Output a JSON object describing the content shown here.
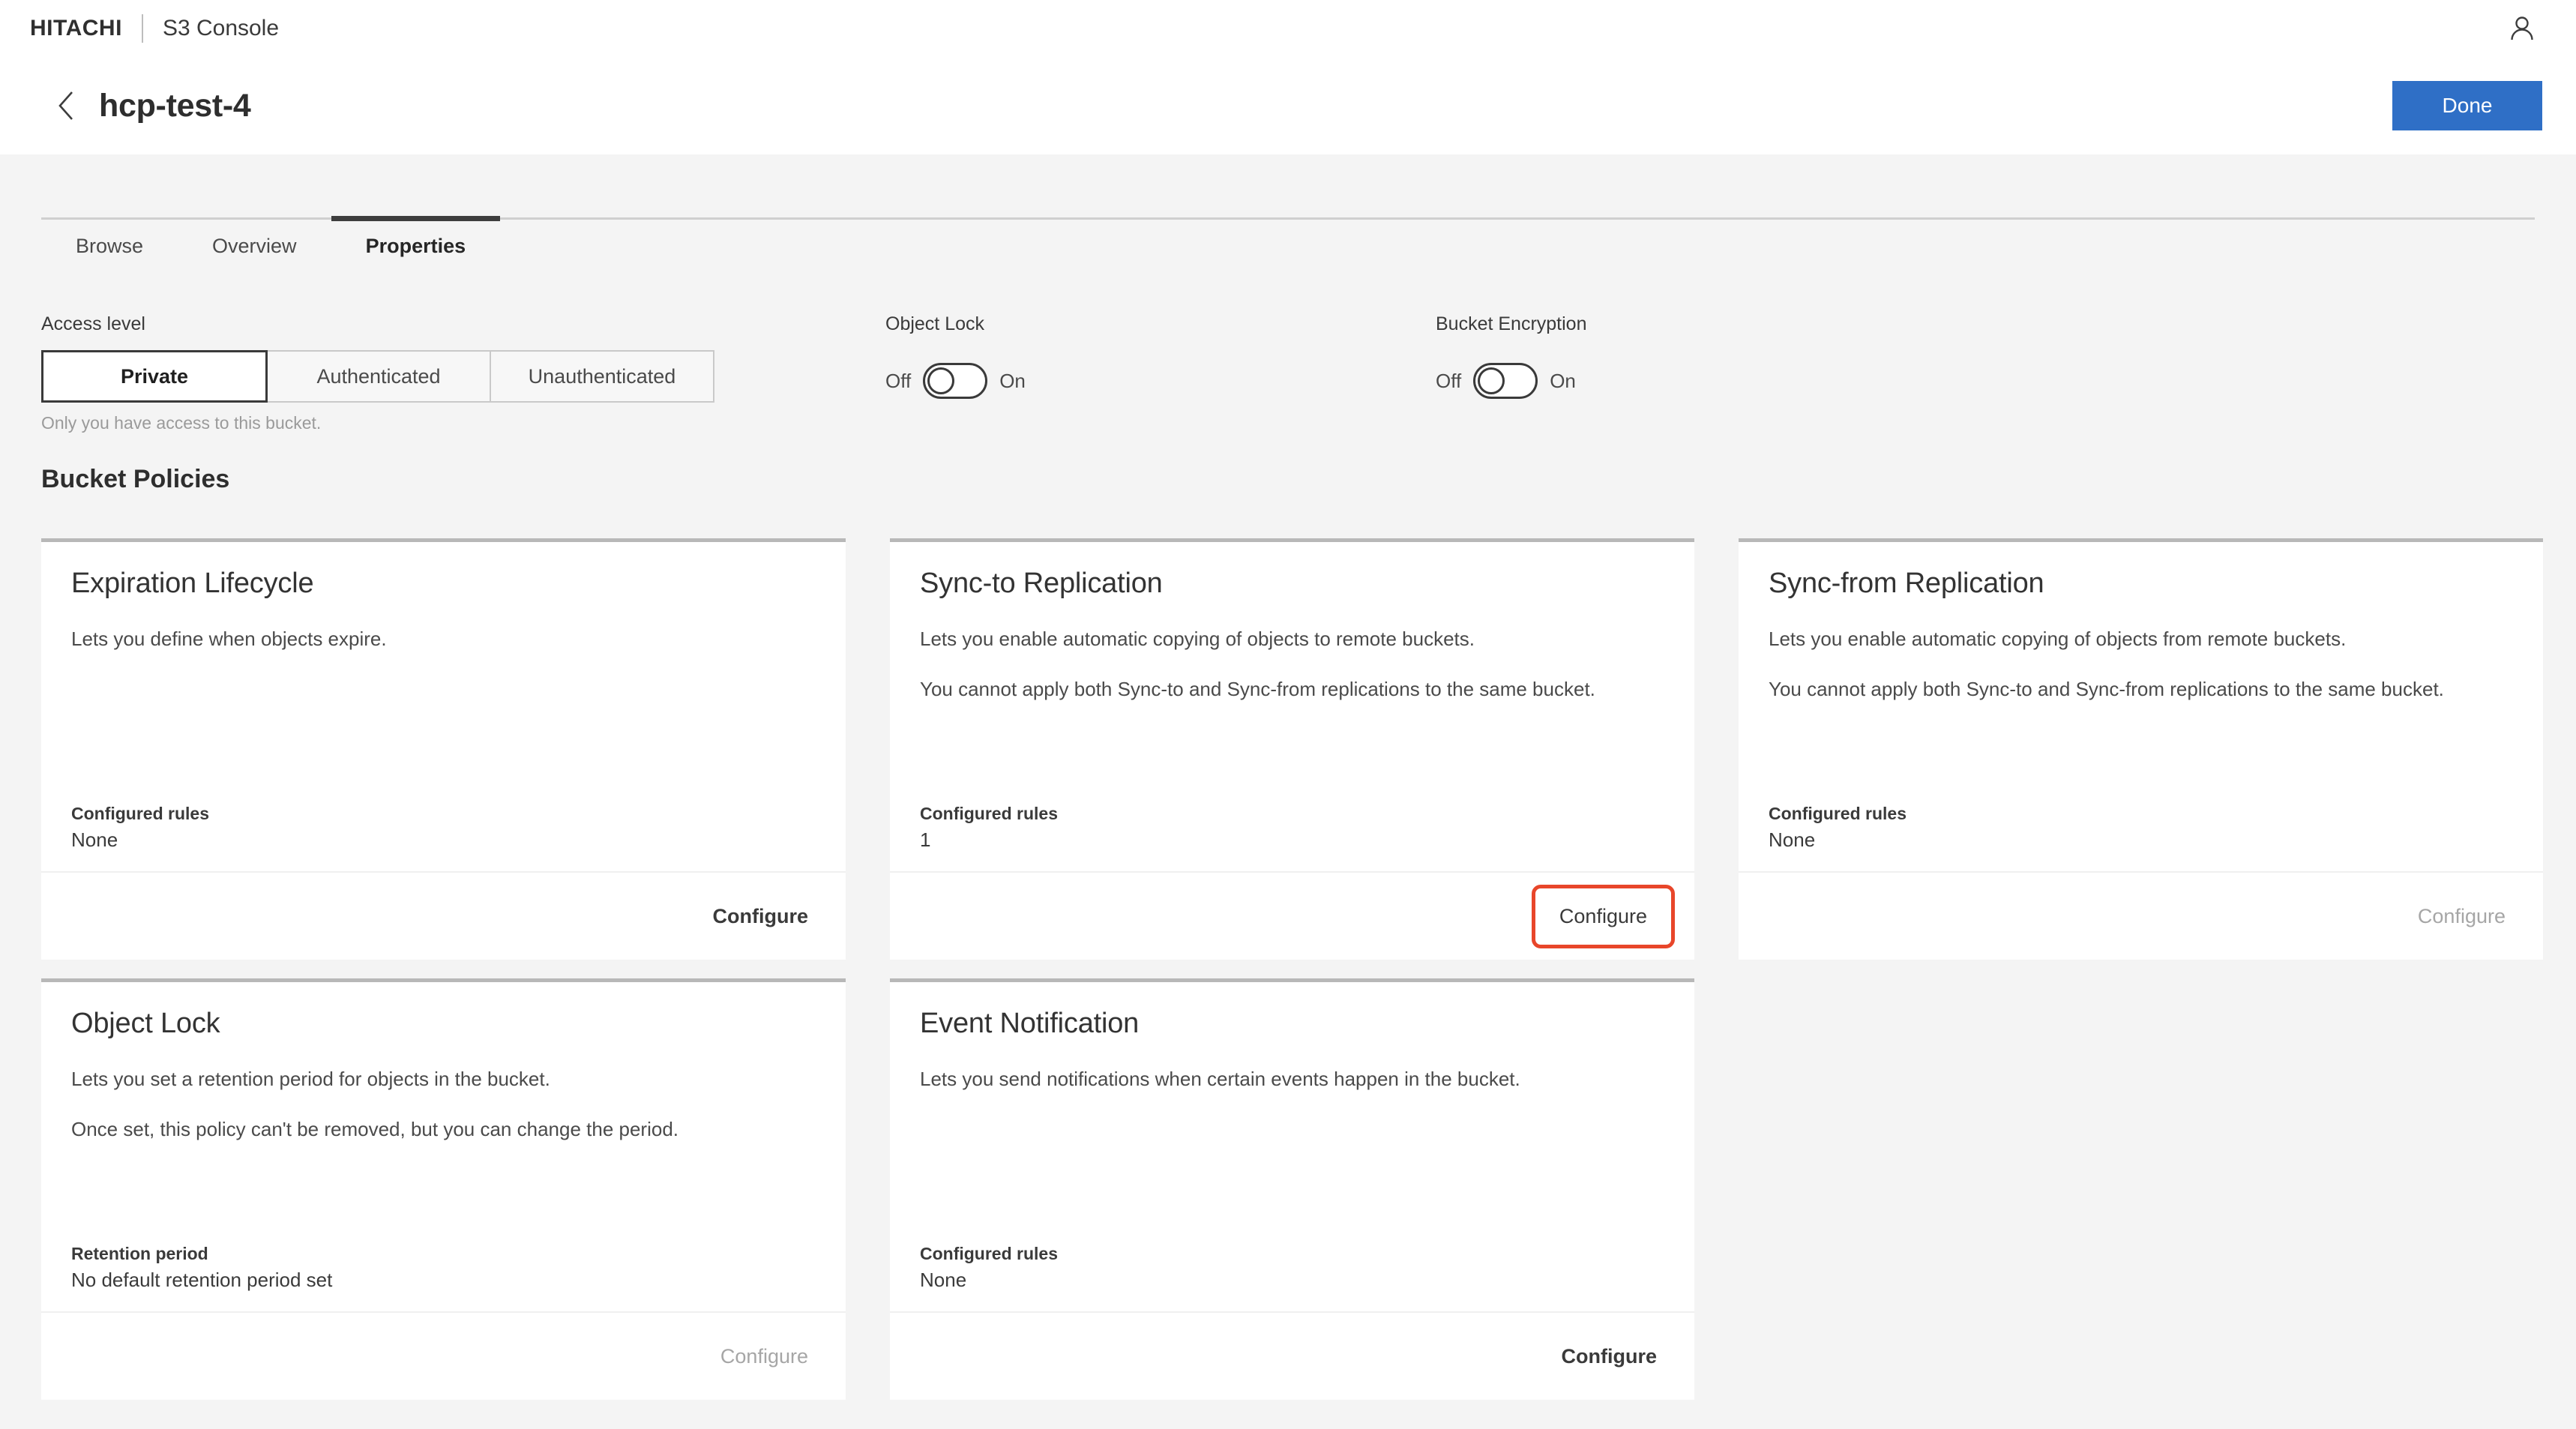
{
  "appbar": {
    "brand": "HITACHI",
    "app_title": "S3 Console",
    "user_icon": "user-avatar-icon"
  },
  "pagehead": {
    "back_icon": "chevron-left-icon",
    "title": "hcp-test-4",
    "done_label": "Done"
  },
  "tabs": [
    {
      "label": "Browse",
      "active": false
    },
    {
      "label": "Overview",
      "active": false
    },
    {
      "label": "Properties",
      "active": true
    }
  ],
  "controls": {
    "access": {
      "label": "Access level",
      "options": [
        "Private",
        "Authenticated",
        "Unauthenticated"
      ],
      "selected": "Private",
      "helper": "Only you have access to this bucket."
    },
    "object_lock": {
      "label": "Object Lock",
      "off_label": "Off",
      "on_label": "On",
      "state": "Off"
    },
    "bucket_encryption": {
      "label": "Bucket Encryption",
      "off_label": "Off",
      "on_label": "On",
      "state": "Off"
    }
  },
  "section": {
    "title": "Bucket Policies"
  },
  "cards": [
    {
      "title": "Expiration Lifecycle",
      "desc1": "Lets you define when objects expire.",
      "desc2": "",
      "meta_label": "Configured rules",
      "meta_value": "None",
      "action_label": "Configure",
      "action_state": "enabled"
    },
    {
      "title": "Sync-to Replication",
      "desc1": "Lets you enable automatic copying of objects to remote buckets.",
      "desc2": "You cannot apply both Sync-to and Sync-from replications to the same bucket.",
      "meta_label": "Configured rules",
      "meta_value": "1",
      "action_label": "Configure",
      "action_state": "focused"
    },
    {
      "title": "Sync-from Replication",
      "desc1": "Lets you enable automatic copying of objects from remote buckets.",
      "desc2": "You cannot apply both Sync-to and Sync-from replications to the same bucket.",
      "meta_label": "Configured rules",
      "meta_value": "None",
      "action_label": "Configure",
      "action_state": "disabled"
    },
    {
      "title": "Object Lock",
      "desc1": "Lets you set a retention period for objects in the bucket.",
      "desc2": "Once set, this policy can't be removed, but you can change the period.",
      "meta_label": "Retention period",
      "meta_value": "No default retention period set",
      "action_label": "Configure",
      "action_state": "disabled"
    },
    {
      "title": "Event Notification",
      "desc1": "Lets you send notifications when certain events happen in the bucket.",
      "desc2": "",
      "meta_label": "Configured rules",
      "meta_value": "None",
      "action_label": "Configure",
      "action_state": "enabled"
    }
  ],
  "colors": {
    "primary_button": "#2f6fc6",
    "focus_outline": "#e8462a",
    "card_top_border": "#b8b8b8",
    "page_background": "#f4f4f4"
  }
}
